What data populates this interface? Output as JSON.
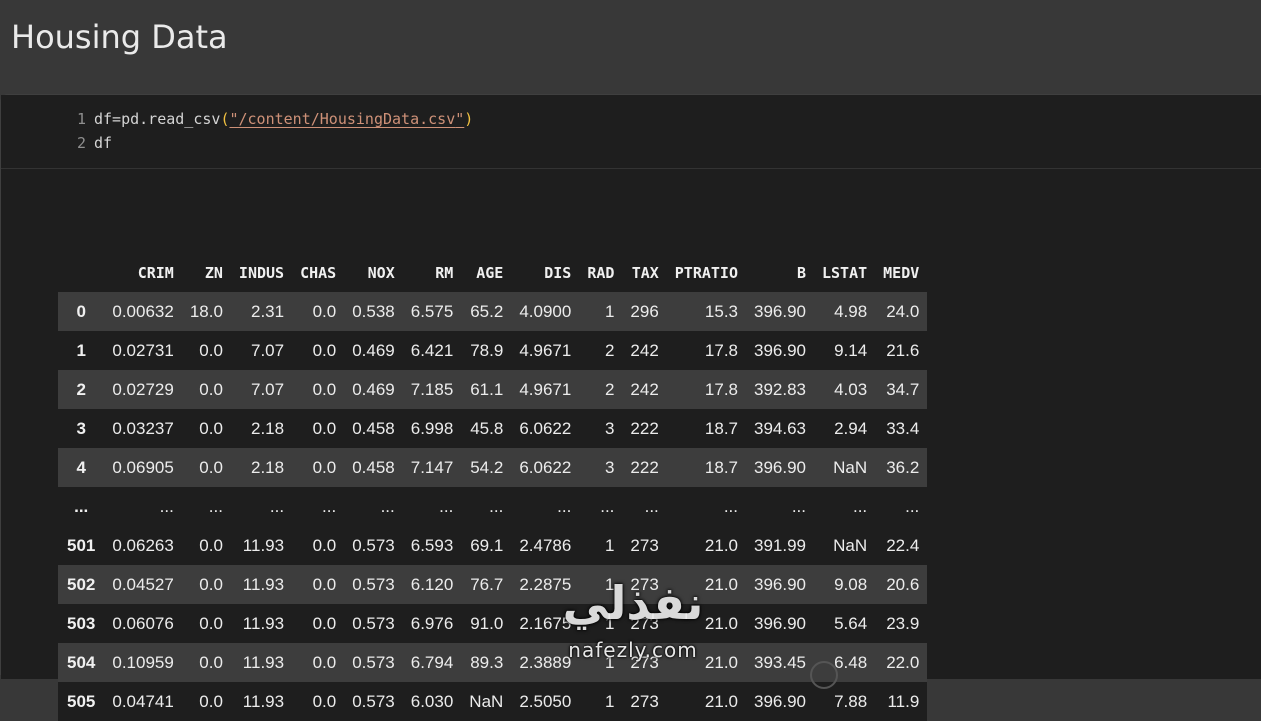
{
  "page": {
    "title": "Housing Data"
  },
  "code": {
    "lines": [
      {
        "num": "1",
        "pre": "df=pd.read_csv",
        "open": "(",
        "q1": "\"",
        "path": "/content/HousingData.csv",
        "q2": "\"",
        "close": ")"
      },
      {
        "num": "2",
        "text": "df"
      }
    ]
  },
  "table": {
    "columns": [
      "CRIM",
      "ZN",
      "INDUS",
      "CHAS",
      "NOX",
      "RM",
      "AGE",
      "DIS",
      "RAD",
      "TAX",
      "PTRATIO",
      "B",
      "LSTAT",
      "MEDV"
    ],
    "rows": [
      {
        "index": "0",
        "cells": [
          "0.00632",
          "18.0",
          "2.31",
          "0.0",
          "0.538",
          "6.575",
          "65.2",
          "4.0900",
          "1",
          "296",
          "15.3",
          "396.90",
          "4.98",
          "24.0"
        ]
      },
      {
        "index": "1",
        "cells": [
          "0.02731",
          "0.0",
          "7.07",
          "0.0",
          "0.469",
          "6.421",
          "78.9",
          "4.9671",
          "2",
          "242",
          "17.8",
          "396.90",
          "9.14",
          "21.6"
        ]
      },
      {
        "index": "2",
        "cells": [
          "0.02729",
          "0.0",
          "7.07",
          "0.0",
          "0.469",
          "7.185",
          "61.1",
          "4.9671",
          "2",
          "242",
          "17.8",
          "392.83",
          "4.03",
          "34.7"
        ]
      },
      {
        "index": "3",
        "cells": [
          "0.03237",
          "0.0",
          "2.18",
          "0.0",
          "0.458",
          "6.998",
          "45.8",
          "6.0622",
          "3",
          "222",
          "18.7",
          "394.63",
          "2.94",
          "33.4"
        ]
      },
      {
        "index": "4",
        "cells": [
          "0.06905",
          "0.0",
          "2.18",
          "0.0",
          "0.458",
          "7.147",
          "54.2",
          "6.0622",
          "3",
          "222",
          "18.7",
          "396.90",
          "NaN",
          "36.2"
        ]
      },
      {
        "index": "...",
        "cells": [
          "...",
          "...",
          "...",
          "...",
          "...",
          "...",
          "...",
          "...",
          "...",
          "...",
          "...",
          "...",
          "...",
          "..."
        ],
        "ellipsis": true
      },
      {
        "index": "501",
        "cells": [
          "0.06263",
          "0.0",
          "11.93",
          "0.0",
          "0.573",
          "6.593",
          "69.1",
          "2.4786",
          "1",
          "273",
          "21.0",
          "391.99",
          "NaN",
          "22.4"
        ]
      },
      {
        "index": "502",
        "cells": [
          "0.04527",
          "0.0",
          "11.93",
          "0.0",
          "0.573",
          "6.120",
          "76.7",
          "2.2875",
          "1",
          "273",
          "21.0",
          "396.90",
          "9.08",
          "20.6"
        ]
      },
      {
        "index": "503",
        "cells": [
          "0.06076",
          "0.0",
          "11.93",
          "0.0",
          "0.573",
          "6.976",
          "91.0",
          "2.1675",
          "1",
          "273",
          "21.0",
          "396.90",
          "5.64",
          "23.9"
        ]
      },
      {
        "index": "504",
        "cells": [
          "0.10959",
          "0.0",
          "11.93",
          "0.0",
          "0.573",
          "6.794",
          "89.3",
          "2.3889",
          "1",
          "273",
          "21.0",
          "393.45",
          "6.48",
          "22.0"
        ]
      },
      {
        "index": "505",
        "cells": [
          "0.04741",
          "0.0",
          "11.93",
          "0.0",
          "0.573",
          "6.030",
          "NaN",
          "2.5050",
          "1",
          "273",
          "21.0",
          "396.90",
          "7.88",
          "11.9"
        ]
      }
    ]
  },
  "watermark": {
    "arabic": "نفذلي",
    "latin": "nafezly.com"
  }
}
